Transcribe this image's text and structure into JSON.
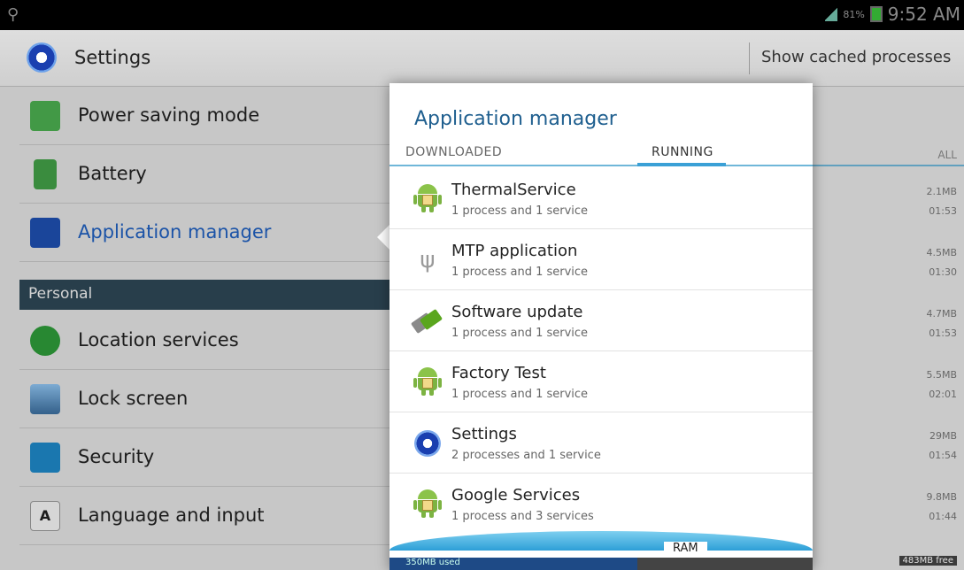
{
  "status": {
    "time": "9:52 AM",
    "battery_pct": "81%"
  },
  "actionbar": {
    "title": "Settings",
    "show_cached": "Show cached processes"
  },
  "leftlist": {
    "items": [
      {
        "label": "Power saving mode",
        "icon": "power-saving-icon",
        "color": "#4caf50"
      },
      {
        "label": "Battery",
        "icon": "battery-icon",
        "color": "#43a047"
      },
      {
        "label": "Application manager",
        "icon": "apps-grid-icon",
        "color": "#1e4fb0"
      }
    ],
    "section": "Personal",
    "items2": [
      {
        "label": "Location services",
        "icon": "location-icon",
        "color": "#2e9b3a"
      },
      {
        "label": "Lock screen",
        "icon": "lock-screen-icon",
        "color": "#4a86c4"
      },
      {
        "label": "Security",
        "icon": "security-lock-icon",
        "color": "#1e88c8"
      },
      {
        "label": "Language and input",
        "icon": "keyboard-a-icon",
        "color": "#333333"
      }
    ]
  },
  "dialog": {
    "title": "Application manager",
    "tabs": [
      "DOWNLOADED",
      "RUNNING",
      "ALL"
    ],
    "selected_tab": "RUNNING",
    "rows": [
      {
        "name": "ThermalService",
        "sub": "1 process and 1 service",
        "icon": "android-icon",
        "size": "2.1MB",
        "time": "01:53"
      },
      {
        "name": "MTP application",
        "sub": "1 process and 1 service",
        "icon": "usb-icon",
        "size": "4.5MB",
        "time": "01:30"
      },
      {
        "name": "Software update",
        "sub": "1 process and 1 service",
        "icon": "software-update-icon",
        "size": "4.7MB",
        "time": "01:53"
      },
      {
        "name": "Factory Test",
        "sub": "1 process and 1 service",
        "icon": "android-icon",
        "size": "5.5MB",
        "time": "02:01"
      },
      {
        "name": "Settings",
        "sub": "2 processes and 1 service",
        "icon": "settings-gear-icon",
        "size": "29MB",
        "time": "01:54"
      },
      {
        "name": "Google Services",
        "sub": "1 process and 3 services",
        "icon": "android-icon",
        "size": "9.8MB",
        "time": "01:44"
      }
    ],
    "ram": {
      "label": "RAM",
      "used": "350MB used",
      "free": "483MB free"
    }
  }
}
